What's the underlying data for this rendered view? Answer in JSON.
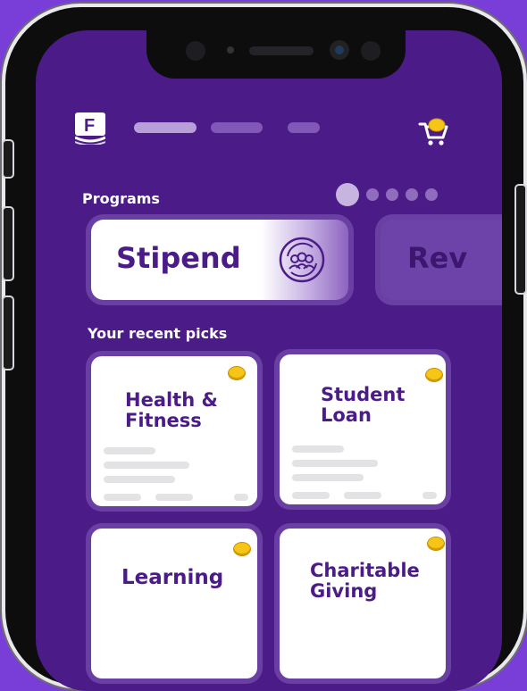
{
  "header": {
    "logo_letter": "F",
    "nav_pills": 3
  },
  "programs": {
    "title": "Programs",
    "carousel_pages": 5,
    "active_page": 1,
    "cards": [
      {
        "label": "Stipend",
        "icon": "community-cycle-icon"
      },
      {
        "label": "Rev"
      }
    ]
  },
  "recent": {
    "title": "Your recent picks",
    "cards": [
      {
        "label": "Health & Fitness",
        "line1": "Health &",
        "line2": "Fitness"
      },
      {
        "label": "Student Loan",
        "line1": "Student",
        "line2": "Loan"
      },
      {
        "label": "Learning",
        "line1": "Learning"
      },
      {
        "label": "Charitable Giving",
        "line1": "Charitable",
        "line2": "Giving"
      }
    ]
  },
  "colors": {
    "background": "#7a3ed8",
    "screen": "#4b1b87",
    "accent_coin": "#f5c518",
    "card": "#ffffff"
  }
}
